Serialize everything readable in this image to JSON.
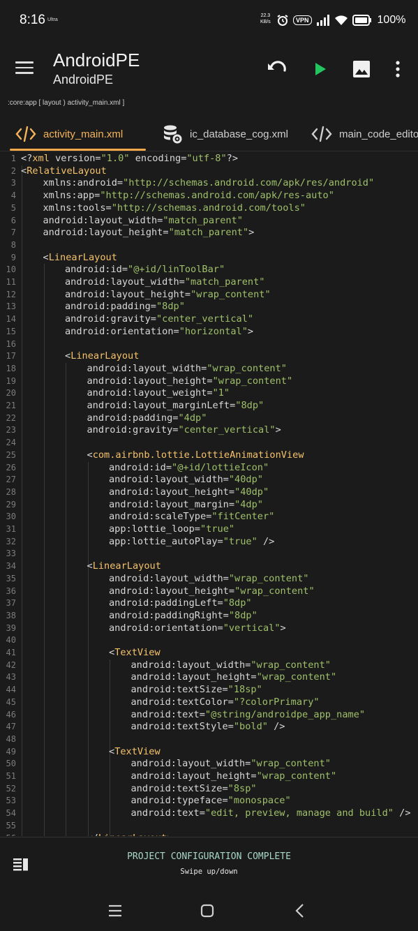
{
  "status": {
    "time": "8:16",
    "ultra": "Ultra",
    "net_speed": "22.3",
    "net_unit": "KB/s",
    "vpn": "VPN",
    "battery": "100%"
  },
  "appbar": {
    "title": "AndroidPE",
    "subtitle": "AndroidPE"
  },
  "breadcrumb": ":core:app [ layout ) activity_main.xml ]",
  "tabs": [
    {
      "label": "activity_main.xml",
      "icon": "code-icon"
    },
    {
      "label": "ic_database_cog.xml",
      "icon": "database-cog-icon"
    },
    {
      "label": "main_code_editor",
      "icon": "code-icon"
    }
  ],
  "editor": {
    "lines": [
      {
        "n": "1",
        "i": 0,
        "t": [
          [
            "pun",
            "<?"
          ],
          [
            "tag",
            "xml"
          ],
          [
            "attr",
            " version="
          ],
          [
            "str",
            "\"1.0\""
          ],
          [
            "attr",
            " encoding="
          ],
          [
            "str",
            "\"utf-8\""
          ],
          [
            "pun",
            "?>"
          ]
        ]
      },
      {
        "n": "2",
        "i": 0,
        "t": [
          [
            "pun",
            "<"
          ],
          [
            "tag",
            "RelativeLayout"
          ]
        ]
      },
      {
        "n": "3",
        "i": 1,
        "t": [
          [
            "attr",
            "xmlns:android="
          ],
          [
            "str",
            "\"http://schemas.android.com/apk/res/android\""
          ]
        ]
      },
      {
        "n": "4",
        "i": 1,
        "t": [
          [
            "attr",
            "xmlns:app="
          ],
          [
            "str",
            "\"http://schemas.android.com/apk/res-auto\""
          ]
        ]
      },
      {
        "n": "5",
        "i": 1,
        "t": [
          [
            "attr",
            "xmlns:tools="
          ],
          [
            "str",
            "\"http://schemas.android.com/tools\""
          ]
        ]
      },
      {
        "n": "6",
        "i": 1,
        "t": [
          [
            "attr",
            "android:layout_width="
          ],
          [
            "str",
            "\"match_parent\""
          ]
        ]
      },
      {
        "n": "7",
        "i": 1,
        "t": [
          [
            "attr",
            "android:layout_height="
          ],
          [
            "str",
            "\"match_parent\""
          ],
          [
            "pun",
            ">"
          ]
        ]
      },
      {
        "n": "8",
        "i": 0,
        "t": []
      },
      {
        "n": "9",
        "i": 1,
        "t": [
          [
            "pun",
            "<"
          ],
          [
            "tag",
            "LinearLayout"
          ]
        ]
      },
      {
        "n": "10",
        "i": 2,
        "t": [
          [
            "attr",
            "android:id="
          ],
          [
            "str",
            "\"@+id/linToolBar\""
          ]
        ]
      },
      {
        "n": "11",
        "i": 2,
        "t": [
          [
            "attr",
            "android:layout_width="
          ],
          [
            "str",
            "\"match_parent\""
          ]
        ]
      },
      {
        "n": "12",
        "i": 2,
        "t": [
          [
            "attr",
            "android:layout_height="
          ],
          [
            "str",
            "\"wrap_content\""
          ]
        ]
      },
      {
        "n": "13",
        "i": 2,
        "t": [
          [
            "attr",
            "android:padding="
          ],
          [
            "str",
            "\"8dp\""
          ]
        ]
      },
      {
        "n": "14",
        "i": 2,
        "t": [
          [
            "attr",
            "android:gravity="
          ],
          [
            "str",
            "\"center_vertical\""
          ]
        ]
      },
      {
        "n": "15",
        "i": 2,
        "t": [
          [
            "attr",
            "android:orientation="
          ],
          [
            "str",
            "\"horizontal\""
          ],
          [
            "pun",
            ">"
          ]
        ]
      },
      {
        "n": "16",
        "i": 0,
        "t": []
      },
      {
        "n": "17",
        "i": 2,
        "t": [
          [
            "pun",
            "<"
          ],
          [
            "tag",
            "LinearLayout"
          ]
        ]
      },
      {
        "n": "18",
        "i": 3,
        "t": [
          [
            "attr",
            "android:layout_width="
          ],
          [
            "str",
            "\"wrap_content\""
          ]
        ]
      },
      {
        "n": "19",
        "i": 3,
        "t": [
          [
            "attr",
            "android:layout_height="
          ],
          [
            "str",
            "\"wrap_content\""
          ]
        ]
      },
      {
        "n": "20",
        "i": 3,
        "t": [
          [
            "attr",
            "android:layout_weight="
          ],
          [
            "str",
            "\"1\""
          ]
        ]
      },
      {
        "n": "21",
        "i": 3,
        "t": [
          [
            "attr",
            "android:layout_marginLeft="
          ],
          [
            "str",
            "\"8dp\""
          ]
        ]
      },
      {
        "n": "22",
        "i": 3,
        "t": [
          [
            "attr",
            "android:padding="
          ],
          [
            "str",
            "\"4dp\""
          ]
        ]
      },
      {
        "n": "23",
        "i": 3,
        "t": [
          [
            "attr",
            "android:gravity="
          ],
          [
            "str",
            "\"center_vertical\""
          ],
          [
            "pun",
            ">"
          ]
        ]
      },
      {
        "n": "24",
        "i": 0,
        "t": []
      },
      {
        "n": "25",
        "i": 3,
        "t": [
          [
            "pun",
            "<"
          ],
          [
            "tag",
            "com.airbnb.lottie.LottieAnimationView"
          ]
        ]
      },
      {
        "n": "26",
        "i": 4,
        "t": [
          [
            "attr",
            "android:id="
          ],
          [
            "str",
            "\"@+id/lottieIcon\""
          ]
        ]
      },
      {
        "n": "27",
        "i": 4,
        "t": [
          [
            "attr",
            "android:layout_width="
          ],
          [
            "str",
            "\"40dp\""
          ]
        ]
      },
      {
        "n": "28",
        "i": 4,
        "t": [
          [
            "attr",
            "android:layout_height="
          ],
          [
            "str",
            "\"40dp\""
          ]
        ]
      },
      {
        "n": "29",
        "i": 4,
        "t": [
          [
            "attr",
            "android:layout_margin="
          ],
          [
            "str",
            "\"4dp\""
          ]
        ]
      },
      {
        "n": "30",
        "i": 4,
        "t": [
          [
            "attr",
            "android:scaleType="
          ],
          [
            "str",
            "\"fitCenter\""
          ]
        ]
      },
      {
        "n": "31",
        "i": 4,
        "t": [
          [
            "attr",
            "app:lottie_loop="
          ],
          [
            "str",
            "\"true\""
          ]
        ]
      },
      {
        "n": "32",
        "i": 4,
        "t": [
          [
            "attr",
            "app:lottie_autoPlay="
          ],
          [
            "str",
            "\"true\""
          ],
          [
            "pun",
            " />"
          ]
        ]
      },
      {
        "n": "33",
        "i": 0,
        "t": []
      },
      {
        "n": "34",
        "i": 3,
        "t": [
          [
            "pun",
            "<"
          ],
          [
            "tag",
            "LinearLayout"
          ]
        ]
      },
      {
        "n": "35",
        "i": 4,
        "t": [
          [
            "attr",
            "android:layout_width="
          ],
          [
            "str",
            "\"wrap_content\""
          ]
        ]
      },
      {
        "n": "36",
        "i": 4,
        "t": [
          [
            "attr",
            "android:layout_height="
          ],
          [
            "str",
            "\"wrap_content\""
          ]
        ]
      },
      {
        "n": "37",
        "i": 4,
        "t": [
          [
            "attr",
            "android:paddingLeft="
          ],
          [
            "str",
            "\"8dp\""
          ]
        ]
      },
      {
        "n": "38",
        "i": 4,
        "t": [
          [
            "attr",
            "android:paddingRight="
          ],
          [
            "str",
            "\"8dp\""
          ]
        ]
      },
      {
        "n": "39",
        "i": 4,
        "t": [
          [
            "attr",
            "android:orientation="
          ],
          [
            "str",
            "\"vertical\""
          ],
          [
            "pun",
            ">"
          ]
        ]
      },
      {
        "n": "40",
        "i": 0,
        "t": []
      },
      {
        "n": "41",
        "i": 4,
        "t": [
          [
            "pun",
            "<"
          ],
          [
            "tag",
            "TextView"
          ]
        ]
      },
      {
        "n": "42",
        "i": 5,
        "t": [
          [
            "attr",
            "android:layout_width="
          ],
          [
            "str",
            "\"wrap_content\""
          ]
        ]
      },
      {
        "n": "43",
        "i": 5,
        "t": [
          [
            "attr",
            "android:layout_height="
          ],
          [
            "str",
            "\"wrap_content\""
          ]
        ]
      },
      {
        "n": "44",
        "i": 5,
        "t": [
          [
            "attr",
            "android:textSize="
          ],
          [
            "str",
            "\"18sp\""
          ]
        ]
      },
      {
        "n": "45",
        "i": 5,
        "t": [
          [
            "attr",
            "android:textColor="
          ],
          [
            "str",
            "\"?colorPrimary\""
          ]
        ]
      },
      {
        "n": "46",
        "i": 5,
        "t": [
          [
            "attr",
            "android:text="
          ],
          [
            "str",
            "\"@string/androidpe_app_name\""
          ]
        ]
      },
      {
        "n": "47",
        "i": 5,
        "t": [
          [
            "attr",
            "android:textStyle="
          ],
          [
            "str",
            "\"bold\""
          ],
          [
            "pun",
            " />"
          ]
        ]
      },
      {
        "n": "48",
        "i": 0,
        "t": []
      },
      {
        "n": "49",
        "i": 4,
        "t": [
          [
            "pun",
            "<"
          ],
          [
            "tag",
            "TextView"
          ]
        ]
      },
      {
        "n": "50",
        "i": 5,
        "t": [
          [
            "attr",
            "android:layout_width="
          ],
          [
            "str",
            "\"wrap_content\""
          ]
        ]
      },
      {
        "n": "51",
        "i": 5,
        "t": [
          [
            "attr",
            "android:layout_height="
          ],
          [
            "str",
            "\"wrap_content\""
          ]
        ]
      },
      {
        "n": "52",
        "i": 5,
        "t": [
          [
            "attr",
            "android:textSize="
          ],
          [
            "str",
            "\"8sp\""
          ]
        ]
      },
      {
        "n": "53",
        "i": 5,
        "t": [
          [
            "attr",
            "android:typeface="
          ],
          [
            "str",
            "\"monospace\""
          ]
        ]
      },
      {
        "n": "54",
        "i": 5,
        "t": [
          [
            "attr",
            "android:text="
          ],
          [
            "str",
            "\"edit, preview, manage and build\""
          ],
          [
            "pun",
            " />"
          ]
        ]
      },
      {
        "n": "55",
        "i": 0,
        "t": []
      },
      {
        "n": "56",
        "i": 3,
        "t": [
          [
            "pun",
            "</"
          ],
          [
            "tag",
            "LinearLayout"
          ],
          [
            "pun",
            ">"
          ]
        ]
      }
    ]
  },
  "bottom": {
    "message": "PROJECT CONFIGURATION COMPLETE",
    "hint": "Swipe up/down"
  }
}
